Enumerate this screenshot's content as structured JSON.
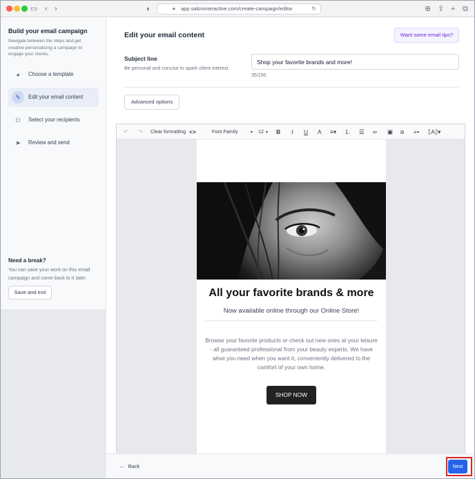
{
  "browser": {
    "url": "app.saloninteractive.com/create-campaign/editor"
  },
  "sidebar": {
    "title": "Build your email campaign",
    "description": "Navigate between the steps and get creative personalizing a campaign to engage your clients.",
    "steps": [
      {
        "label": "Choose a template",
        "icon": "palette-icon",
        "active": false
      },
      {
        "label": "Edit your email content",
        "icon": "pencil-icon",
        "active": true
      },
      {
        "label": "Select your recipients",
        "icon": "user-icon",
        "active": false
      },
      {
        "label": "Review and send",
        "icon": "send-icon",
        "active": false
      }
    ],
    "break_title": "Need a break?",
    "break_desc": "You can save your work on this email campaign and come back to it later.",
    "save_exit": "Save and exit"
  },
  "main": {
    "title": "Edit your email content",
    "tips_button": "Want some email tips?",
    "subject_label": "Subject line",
    "subject_help": "Be personal and concise to spark client interest.",
    "subject_value": "Shop your favorite brands and more!",
    "subject_count": "35/150",
    "advanced_button": "Advanced options"
  },
  "toolbar": {
    "clear_formatting": "Clear formatting",
    "font_family": "Font Family",
    "font_size": "12"
  },
  "email": {
    "headline": "All your favorite brands & more",
    "subheadline": "Now available online through our Online Store!",
    "body": "Browse your favorite products or check out new ones at your leisure - all guaranteed professional from your beauty experts. We have what you need when you want it, conveniently delivered to the comfort of your own home.",
    "cta": "SHOP NOW"
  },
  "footer": {
    "back": "Back",
    "next": "Next"
  },
  "colors": {
    "accent": "#2563eb",
    "highlight": "#dc2626",
    "tips": "#6d28d9"
  }
}
